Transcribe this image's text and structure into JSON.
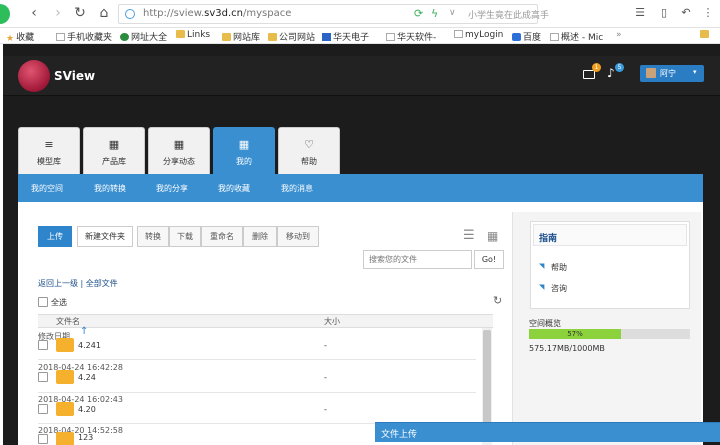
{
  "browser": {
    "url_prefix": "http://sview.",
    "url_domain": "sv3d.cn",
    "url_path": "/myspace",
    "search_hint": "小学生竟在此成高手",
    "bookmarks": [
      "收藏",
      "手机收藏夹",
      "网址大全",
      "Links",
      "网站库",
      "公司网站",
      "华天电子",
      "华天软件-",
      "myLogin",
      "百度",
      "概述 - Mic"
    ]
  },
  "app": {
    "brand": "SView",
    "mail_badge": "1",
    "bell_badge": "5",
    "user_name": "阿宁"
  },
  "tabs": [
    {
      "label": "模型库",
      "icon": "≡"
    },
    {
      "label": "产品库",
      "icon": "▦"
    },
    {
      "label": "分享动态",
      "icon": "▦"
    },
    {
      "label": "我的",
      "icon": "▦"
    },
    {
      "label": "帮助",
      "icon": "♡"
    }
  ],
  "subnav": [
    "我的空间",
    "我的转换",
    "我的分享",
    "我的收藏",
    "我的消息"
  ],
  "toolbar": {
    "upload": "上传",
    "new_folder": "新建文件夹",
    "actions": [
      "转换",
      "下载",
      "重命名",
      "删除",
      "移动到"
    ],
    "search_placeholder": "搜索您的文件",
    "go": "Go!"
  },
  "breadcrumb": {
    "back": "返回上一级",
    "sep": "|",
    "all": "全部文件"
  },
  "select_all": "全选",
  "columns": {
    "name": "文件名",
    "size": "大小",
    "date": "修改日期"
  },
  "files": [
    {
      "name": "4.241",
      "size": "-",
      "date": "2018-04-24 16:42:28"
    },
    {
      "name": "4.24",
      "size": "-",
      "date": "2018-04-24 16:02:43"
    },
    {
      "name": "4.20",
      "size": "-",
      "date": "2018-04-20 14:52:58"
    },
    {
      "name": "123",
      "size": "-",
      "date": ""
    }
  ],
  "guide": {
    "title": "指南",
    "items": [
      "帮助",
      "咨询"
    ]
  },
  "space": {
    "title": "空间概览",
    "percent_label": "57%",
    "used_fraction": 0.57,
    "text": "575.17MB/1000MB"
  },
  "upload_bar": "文件上传"
}
